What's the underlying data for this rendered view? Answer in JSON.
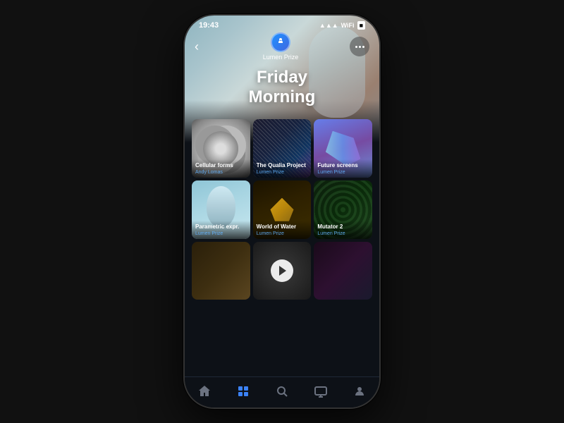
{
  "status_bar": {
    "time": "19:43",
    "signal": "●●●",
    "wifi": "WiFi",
    "battery": "Battery"
  },
  "header": {
    "back_label": "‹",
    "profile_name": "Lumen Prize",
    "more_label": "•••",
    "greeting_line1": "Friday",
    "greeting_line2": "Morning"
  },
  "grid": {
    "items": [
      {
        "title": "Cellular forms",
        "subtitle": "Andy Lomas",
        "art_class": "art-cellular"
      },
      {
        "title": "The Qualia Project",
        "subtitle": "Lumen Prize",
        "art_class": "art-qualia"
      },
      {
        "title": "Future screens",
        "subtitle": "Lumen Prize",
        "art_class": "art-future"
      },
      {
        "title": "Parametric expr.",
        "subtitle": "Lumen Prize",
        "art_class": "art-parametric"
      },
      {
        "title": "World of Water",
        "subtitle": "Lumen Prize",
        "art_class": "art-water"
      },
      {
        "title": "Mutator 2",
        "subtitle": "Lumen Prize",
        "art_class": "art-mutator"
      },
      {
        "title": "",
        "subtitle": "",
        "art_class": "art-bottom-left"
      },
      {
        "title": "",
        "subtitle": "",
        "art_class": "art-bottom-mid",
        "has_play": true
      },
      {
        "title": "",
        "subtitle": "",
        "art_class": "art-bottom-right"
      }
    ]
  },
  "bottom_nav": {
    "items": [
      {
        "icon": "⌂",
        "label": "home",
        "active": false
      },
      {
        "icon": "⊞",
        "label": "grid",
        "active": true
      },
      {
        "icon": "⊙",
        "label": "search",
        "active": false
      },
      {
        "icon": "▭",
        "label": "screen",
        "active": false
      },
      {
        "icon": "◉",
        "label": "profile",
        "active": false
      }
    ]
  }
}
